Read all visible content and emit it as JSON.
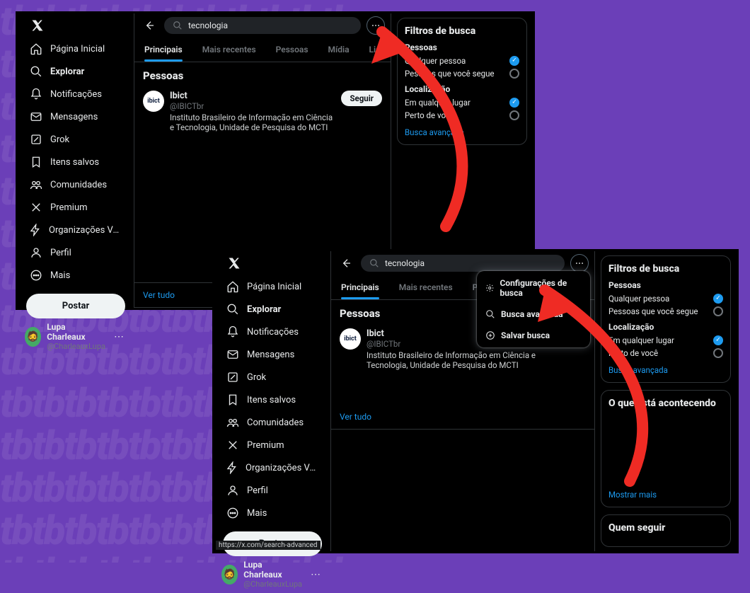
{
  "bg_text": "tbtbtbtbtbtbtbtbtbtbtb\ntbtbtbtbtbtbtbtbtbtbtb\ntbtbtbtbtbtbtbtbtbtbtb\ntbtbtbtbtbtbtbtbtbtbtb\ntbtbtbtbtbtbtbtbtbtbtb\ntbtbtbtbtbtbtbtbtbtbtb\ntbtbtbtbtbtbtbtbtbtbtb\ntbtbtbtbtbtbtbtbtbtbtb\ntbtbtbtbtbtbtbtbtbtbtb\ntbtbtbtbtbtbtbtbtbtbtb\ntbtbtbtbtbtbtbtbtbtbtb\ntbtbtbtbtbtbtbtbtbtbtb\ntbtbtbtbtbtbtbtbtbtbtb\ntbtbtbtbtbtbtbtbtbtbtb",
  "nav": {
    "items": [
      {
        "label": "Página Inicial"
      },
      {
        "label": "Explorar"
      },
      {
        "label": "Notificações"
      },
      {
        "label": "Mensagens"
      },
      {
        "label": "Grok"
      },
      {
        "label": "Itens salvos"
      },
      {
        "label": "Comunidades"
      },
      {
        "label": "Premium"
      },
      {
        "label": "Organizações Verificadas"
      },
      {
        "label": "Perfil"
      },
      {
        "label": "Mais"
      }
    ],
    "post": "Postar"
  },
  "user": {
    "name": "Lupa Charleaux",
    "handle": "@CharleauxLupa",
    "emoji": "🧔"
  },
  "search": {
    "query": "tecnologia"
  },
  "tabs": {
    "principais": "Principais",
    "mais_recentes": "Mais recentes",
    "pessoas": "Pessoas",
    "midia": "Mídia",
    "listas": "Listas"
  },
  "people": {
    "heading": "Pessoas",
    "item": {
      "avatar_text": "ibict",
      "name": "Ibict",
      "handle": "@IBICTbr",
      "bio": "Instituto Brasileiro de Informação em Ciência e Tecnologia, Unidade de Pesquisa do MCTI",
      "follow": "Seguir"
    },
    "see_all": "Ver tudo"
  },
  "filters": {
    "title": "Filtros de busca",
    "people_head": "Pessoas",
    "people_any": "Qualquer pessoa",
    "people_follow": "Pessoas que você segue",
    "loc_head": "Localização",
    "loc_any": "Em qualquer lugar",
    "loc_near": "Perto de você",
    "advanced": "Busca avançada"
  },
  "trends": {
    "title": "O que está acontecendo",
    "show_more": "Mostrar mais"
  },
  "who": {
    "title": "Quem seguir"
  },
  "popup": {
    "settings": "Configurações de busca",
    "advanced": "Busca avançada",
    "save": "Salvar busca"
  },
  "url_hint": "https://x.com/search-advanced"
}
